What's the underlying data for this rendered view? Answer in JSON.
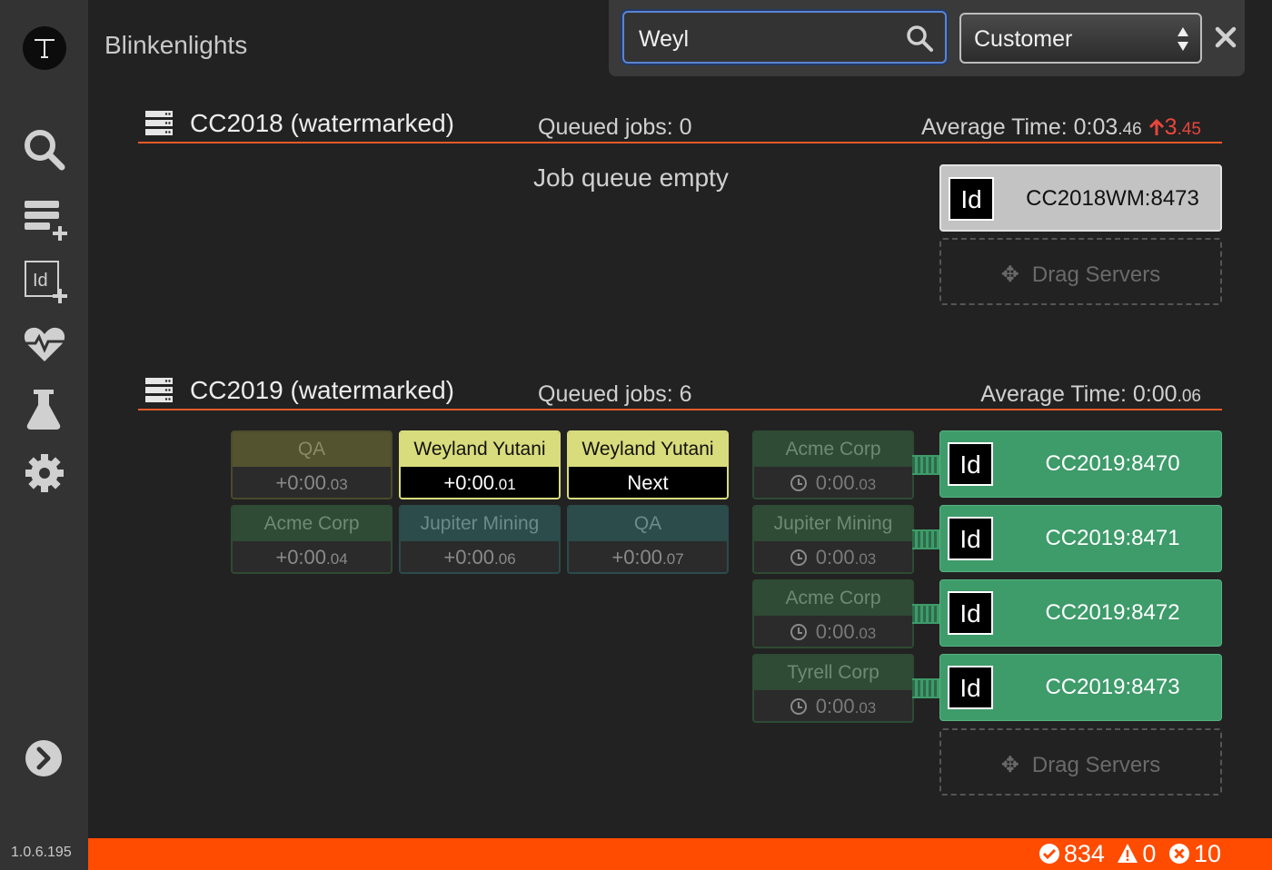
{
  "app": {
    "title": "Blinkenlights",
    "version": "1.0.6.195"
  },
  "search": {
    "value": "Weyl",
    "filter_selected": "Customer"
  },
  "sidebar": {
    "items": [
      {
        "name": "search-icon"
      },
      {
        "name": "add-queue-icon"
      },
      {
        "name": "add-server-icon"
      },
      {
        "name": "health-icon"
      },
      {
        "name": "lab-flask-icon"
      },
      {
        "name": "settings-gear-icon"
      },
      {
        "name": "expand-chevron-icon"
      }
    ]
  },
  "sections": [
    {
      "title": "CC2018 (watermarked)",
      "queued": "Queued jobs: 0",
      "avg_label": "Average Time: 0:03",
      "avg_small": ".46",
      "avg_delta": "3",
      "avg_delta_small": ".45",
      "empty_text": "Job queue empty",
      "servers": [
        {
          "icon": "Id",
          "name": "CC2018WM:8473"
        }
      ],
      "drop_label": "Drag Servers"
    },
    {
      "title": "CC2019 (watermarked)",
      "queued": "Queued jobs: 6",
      "avg_label": "Average Time: 0:00",
      "avg_small": ".06",
      "queue": [
        {
          "customer": "QA",
          "time": "+0:00",
          "time_small": ".03"
        },
        {
          "customer": "Weyland Yutani",
          "time": "+0:00",
          "time_small": ".01"
        },
        {
          "customer": "Weyland Yutani",
          "time": "Next",
          "time_small": ""
        },
        {
          "customer": "Acme Corp",
          "time": "+0:00",
          "time_small": ".04"
        },
        {
          "customer": "Jupiter Mining",
          "time": "+0:00",
          "time_small": ".06"
        },
        {
          "customer": "QA",
          "time": "+0:00",
          "time_small": ".07"
        }
      ],
      "running": [
        {
          "customer": "Acme Corp",
          "time": "0:00",
          "time_small": ".03"
        },
        {
          "customer": "Jupiter Mining",
          "time": "0:00",
          "time_small": ".03"
        },
        {
          "customer": "Acme Corp",
          "time": "0:00",
          "time_small": ".03"
        },
        {
          "customer": "Tyrell Corp",
          "time": "0:00",
          "time_small": ".03"
        }
      ],
      "servers": [
        {
          "icon": "Id",
          "name": "CC2019:8470"
        },
        {
          "icon": "Id",
          "name": "CC2019:8471"
        },
        {
          "icon": "Id",
          "name": "CC2019:8472"
        },
        {
          "icon": "Id",
          "name": "CC2019:8473"
        }
      ],
      "drop_label": "Drag Servers"
    }
  ],
  "status": {
    "ok": "834",
    "warn": "0",
    "err": "10"
  },
  "colors": {
    "accent": "#ff4c00",
    "server_green": "#3e9b6a",
    "highlight_yellow": "#d9dc7c"
  }
}
